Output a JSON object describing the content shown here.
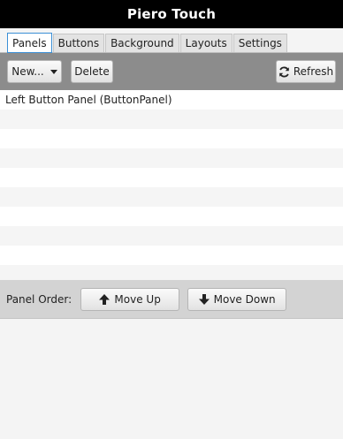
{
  "app": {
    "title": "Piero Touch"
  },
  "tabs": [
    {
      "label": "Panels",
      "active": true
    },
    {
      "label": "Buttons",
      "active": false
    },
    {
      "label": "Background",
      "active": false
    },
    {
      "label": "Layouts",
      "active": false
    },
    {
      "label": "Settings",
      "active": false
    }
  ],
  "toolbar": {
    "new_label": "New...",
    "delete_label": "Delete",
    "refresh_label": "Refresh"
  },
  "panel_list": {
    "items": [
      "Left Button Panel (ButtonPanel)"
    ]
  },
  "order": {
    "label": "Panel Order:",
    "move_up_label": "Move Up",
    "move_down_label": "Move Down"
  },
  "icons": {
    "refresh": "refresh-icon",
    "move_up": "arrow-up-icon",
    "move_down": "arrow-down-icon",
    "dropdown": "chevron-down-icon"
  },
  "colors": {
    "titlebar": "#000000",
    "toolbar": "#8c8c8c",
    "active_tab_border": "#3b8fd6",
    "order_bar": "#d3d3d3"
  }
}
